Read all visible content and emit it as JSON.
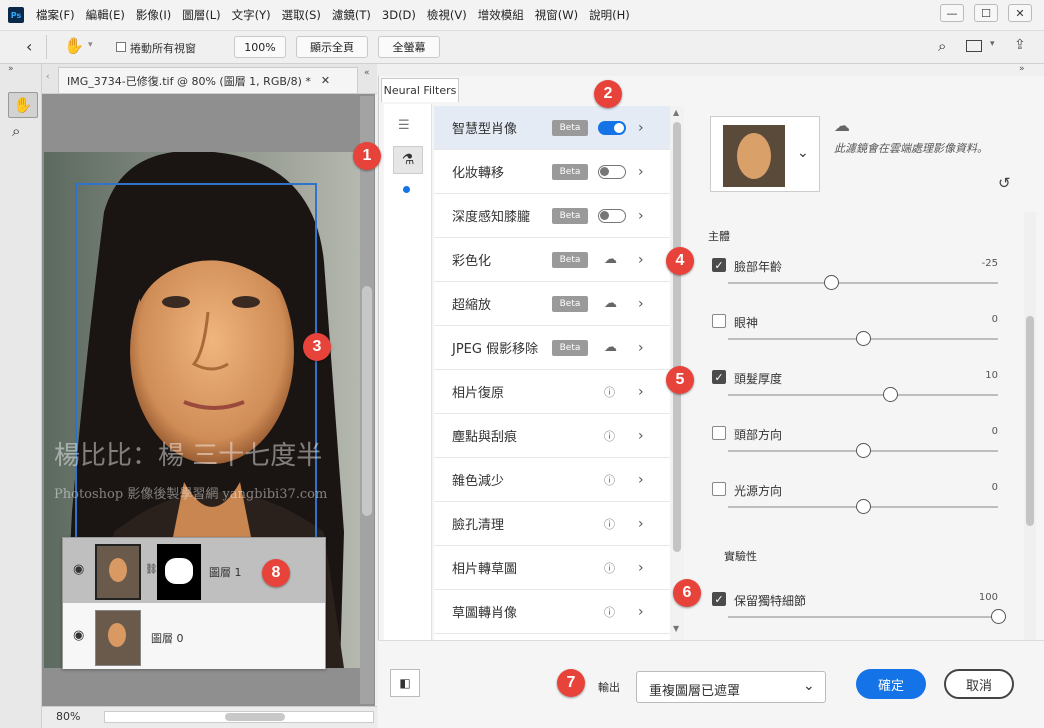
{
  "app": {
    "logo": "Ps"
  },
  "menu": [
    "檔案(F)",
    "編輯(E)",
    "影像(I)",
    "圖層(L)",
    "文字(Y)",
    "選取(S)",
    "濾鏡(T)",
    "3D(D)",
    "檢視(V)",
    "增效模組",
    "視窗(W)",
    "說明(H)"
  ],
  "window_controls": {
    "minimize": "—",
    "maximize": "☐",
    "close": "✕"
  },
  "options": {
    "scroll_all_label": "捲動所有視窗",
    "zoom_value": "100%",
    "fit_screen": "顯示全頁",
    "fill_screen": "全螢幕"
  },
  "document": {
    "tab_title": "IMG_3734-已修復.tif @ 80% (圖層 1, RGB/8) *",
    "zoom": "80%",
    "watermark_line1": "楊比比：楊  三十七度半",
    "watermark_line2": "Photoshop 影像後製學習網 yangbibi37.com"
  },
  "layers": [
    {
      "name": "圖層 1"
    },
    {
      "name": "圖層 0"
    }
  ],
  "neural_filters": {
    "tab_label": "Neural Filters",
    "filters": [
      {
        "label": "智慧型肖像",
        "beta": "Beta",
        "state": "toggle-on"
      },
      {
        "label": "化妝轉移",
        "beta": "Beta",
        "state": "toggle-off"
      },
      {
        "label": "深度感知膝朧",
        "beta": "Beta",
        "state": "toggle-off"
      },
      {
        "label": "彩色化",
        "beta": "Beta",
        "state": "cloud"
      },
      {
        "label": "超縮放",
        "beta": "Beta",
        "state": "cloud"
      },
      {
        "label": "JPEG 假影移除",
        "beta": "Beta",
        "state": "cloud"
      },
      {
        "label": "相片復原",
        "beta": "",
        "state": "info"
      },
      {
        "label": "塵點與刮痕",
        "beta": "",
        "state": "info"
      },
      {
        "label": "雜色減少",
        "beta": "",
        "state": "info"
      },
      {
        "label": "臉孔清理",
        "beta": "",
        "state": "info"
      },
      {
        "label": "相片轉草圖",
        "beta": "",
        "state": "info"
      },
      {
        "label": "草圖轉肖像",
        "beta": "",
        "state": "info"
      }
    ],
    "cloud_note": "此濾鏡會在雲端處理影像資料。",
    "section_subject": "主體",
    "sliders": [
      {
        "label": "臉部年齡",
        "value": "-25",
        "checked": true,
        "position": 0.38
      },
      {
        "label": "眼神",
        "value": "0",
        "checked": false,
        "position": 0.5
      },
      {
        "label": "頭髮厚度",
        "value": "10",
        "checked": true,
        "position": 0.6
      },
      {
        "label": "頭部方向",
        "value": "0",
        "checked": false,
        "position": 0.5
      },
      {
        "label": "光源方向",
        "value": "0",
        "checked": false,
        "position": 0.5
      }
    ],
    "section_experimental": "實驗性",
    "experimental": {
      "label": "保留獨特細節",
      "value": "100",
      "checked": true,
      "position": 1.0
    },
    "output_label": "輸出",
    "output_value": "重複圖層已遮罩",
    "ok": "確定",
    "cancel": "取消"
  },
  "callouts": [
    "1",
    "2",
    "3",
    "4",
    "5",
    "6",
    "7",
    "8"
  ],
  "colors": {
    "accent": "#1473e6",
    "callout": "#e8433a",
    "selection": "#e4ebf5"
  }
}
